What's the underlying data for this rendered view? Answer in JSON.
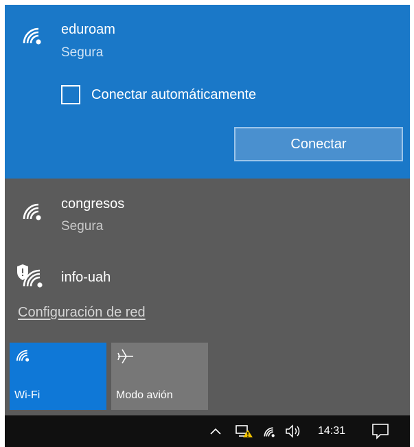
{
  "selected_network": {
    "name": "eduroam",
    "status": "Segura",
    "auto_connect_label": "Conectar automáticamente",
    "auto_connect_checked": false,
    "connect_label": "Conectar"
  },
  "networks": [
    {
      "name": "congresos",
      "status": "Segura",
      "icon": "wifi-icon"
    },
    {
      "name": "info-uah",
      "status": "",
      "icon": "wifi-shield-icon"
    }
  ],
  "network_settings_label": "Configuración de red",
  "quick_actions": [
    {
      "label": "Wi-Fi",
      "icon": "wifi-icon",
      "active": true
    },
    {
      "label": "Modo avión",
      "icon": "airplane-icon",
      "active": false
    }
  ],
  "taskbar": {
    "clock": "14:31",
    "tray_icons": [
      "chevron-up-icon",
      "network-warning-icon",
      "wifi-icon",
      "speaker-icon",
      "notification-icon"
    ]
  },
  "colors": {
    "selected_bg": "#1a78c8",
    "flyout_bg": "#5b5b5b",
    "wifi_tile": "#0f78d7",
    "airplane_tile": "#777777",
    "taskbar_bg": "#101010"
  }
}
